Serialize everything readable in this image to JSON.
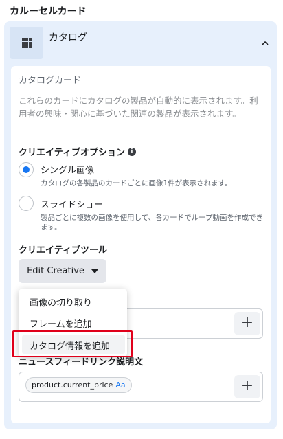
{
  "section": {
    "title": "カルーセルカード"
  },
  "catalog": {
    "icon": "grid-icon",
    "title": "カタログ",
    "collapse_icon": "chevron-up-icon"
  },
  "card": {
    "heading": "カタログカード",
    "description": "これらのカードにカタログの製品が自動的に表示されます。利用者の興味・関心に基づいた関連の製品が表示されます。"
  },
  "creative_options": {
    "heading": "クリエイティブオプション",
    "info_icon": "info-icon",
    "options": [
      {
        "label": "シングル画像",
        "description": "カタログの各製品のカードごとに画像1件が表示されます。",
        "selected": true
      },
      {
        "label": "スライドショー",
        "description": "製品ごとに複数の画像を使用して、各カードでループ動画を作成できます。",
        "selected": false
      }
    ]
  },
  "creative_tools": {
    "heading": "クリエイティブツール",
    "edit_button": "Edit Creative"
  },
  "dropdown": {
    "items": [
      "画像の切り取り",
      "フレームを追加",
      "カタログ情報を追加"
    ],
    "highlighted_index": 2
  },
  "news_feed_link": {
    "heading": "ニュースフィードリンク説明文",
    "token_label": "product.current_price",
    "token_suffix": "Aa"
  },
  "plus_label": "+",
  "colors": {
    "accent": "#1877f2",
    "highlight": "#e0001b",
    "panel": "#e7f0fc"
  }
}
